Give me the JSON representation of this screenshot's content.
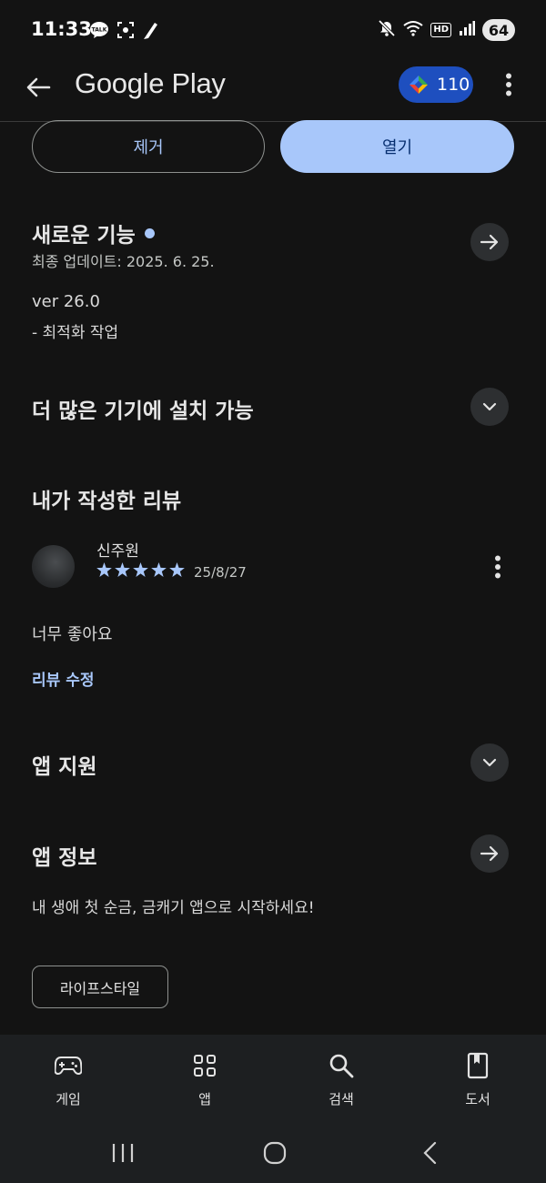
{
  "status_bar": {
    "time": "11:33",
    "left_icons": [
      "talk-icon",
      "screenshot-icon",
      "pen-icon"
    ],
    "right_icons": [
      "mute-icon",
      "wifi-icon",
      "hd-icon",
      "signal-icon"
    ],
    "hd_label": "HD",
    "battery": "64"
  },
  "app_bar": {
    "title": "Google Play",
    "points": "110"
  },
  "actions": {
    "remove": "제거",
    "open": "열기"
  },
  "whats_new": {
    "title": "새로운 기능",
    "last_update": "최종 업데이트: 2025. 6. 25.",
    "version": "ver 26.0",
    "note": "- 최적화 작업"
  },
  "more_devices": {
    "title": "더 많은 기기에 설치 가능"
  },
  "my_review": {
    "title": "내가 작성한 리뷰",
    "reviewer": "신주원",
    "rating": 5,
    "date": "25/8/27",
    "text": "너무 좋아요",
    "edit_label": "리뷰 수정"
  },
  "app_support": {
    "title": "앱 지원"
  },
  "app_info": {
    "title": "앱 정보",
    "description": "내 생애 첫 순금, 금캐기 앱으로 시작하세요!",
    "tag": "라이프스타일"
  },
  "bottom_nav": {
    "items": [
      {
        "label": "게임",
        "icon": "gamepad-icon"
      },
      {
        "label": "앱",
        "icon": "apps-grid-icon"
      },
      {
        "label": "검색",
        "icon": "search-icon"
      },
      {
        "label": "도서",
        "icon": "book-icon"
      }
    ]
  },
  "colors": {
    "background": "#131313",
    "accent": "#a8c7fa",
    "points_chip": "#1e4fbf",
    "round_button": "#2d2f31",
    "nav_bar": "#1d1f21"
  }
}
